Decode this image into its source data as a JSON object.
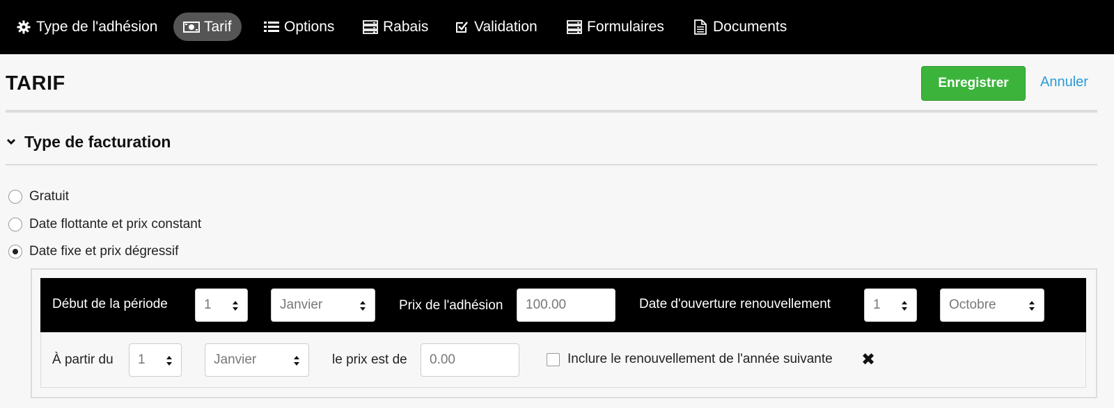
{
  "nav": {
    "items": [
      {
        "label": "Type de l'adhésion",
        "icon": "gear-icon"
      },
      {
        "label": "Tarif",
        "icon": "money-icon",
        "active": true
      },
      {
        "label": "Options",
        "icon": "list-icon"
      },
      {
        "label": "Rabais",
        "icon": "server-icon"
      },
      {
        "label": "Validation",
        "icon": "check-square-icon"
      },
      {
        "label": "Formulaires",
        "icon": "server-icon"
      },
      {
        "label": "Documents",
        "icon": "file-icon"
      }
    ]
  },
  "header": {
    "title": "TARIF",
    "save_label": "Enregistrer",
    "cancel_label": "Annuler"
  },
  "section": {
    "title": "Type de facturation",
    "options": [
      {
        "label": "Gratuit",
        "checked": false
      },
      {
        "label": "Date flottante et prix constant",
        "checked": false
      },
      {
        "label": "Date fixe et prix dégressif",
        "checked": true
      }
    ]
  },
  "period": {
    "start_label": "Début de la période",
    "start_day": "1",
    "start_month": "Janvier",
    "price_label": "Prix de l'adhésion",
    "price_value": "100.00",
    "renewal_label": "Date d'ouverture renouvellement",
    "renewal_day": "1",
    "renewal_month": "Octobre"
  },
  "tier": {
    "from_label": "À partir du",
    "from_day": "1",
    "from_month": "Janvier",
    "price_label": "le prix est de",
    "price_placeholder": "0.00",
    "include_label": "Inclure le renouvellement de l'année suivante",
    "include_checked": false
  },
  "colors": {
    "nav_bg": "#000000",
    "active_tab": "#555555",
    "save_green": "#3cb43c",
    "link_blue": "#2a9bd6"
  }
}
